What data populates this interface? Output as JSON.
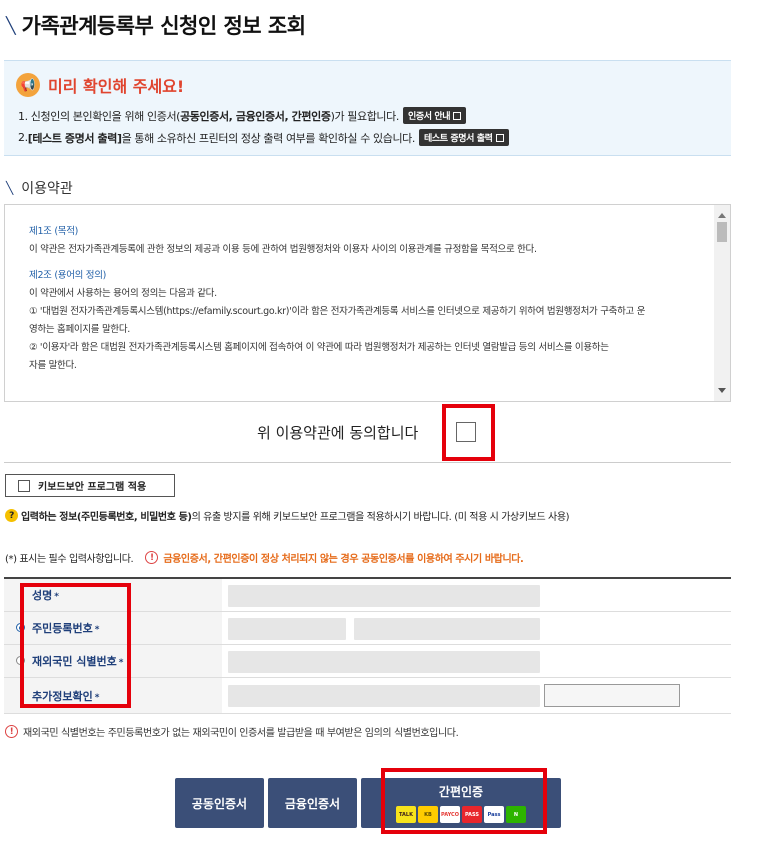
{
  "page": {
    "title": "가족관계등록부 신청인 정보 조회"
  },
  "notice": {
    "title": "미리 확인해 주세요!",
    "line1_pre": "1. 신청인의 본인확인을 위해 인증서(",
    "line1_bold": "공동인증서, 금융인증서, 간편인증",
    "line1_post": ")가 필요합니다.",
    "line1_button": "인증서 안내",
    "line2_pre": "2. ",
    "line2_bold": "[테스트 증명서 출력]",
    "line2_post": "을 통해 소유하신 프린터의 정상 출력 여부를 확인하실 수 있습니다.",
    "line2_button": "테스트 증명서 출력"
  },
  "terms": {
    "section_title": "이용약관",
    "article1_title": "제1조 (목적)",
    "article1_body": "이 약관은 전자가족관계등록에 관한 정보의 제공과 이용 등에 관하여 법원행정처와 이용자 사이의 이용관계를 규정함을 목적으로 한다.",
    "article2_title": "제2조 (용어의 정의)",
    "article2_intro": "이 약관에서 사용하는 용어의 정의는 다음과 같다.",
    "article2_item1a": "① '대법원 전자가족관계등록시스템(https://efamily.scourt.go.kr)'이라 함은 전자가족관계등록 서비스를 인터넷으로 제공하기 위하여 법원행정처가 구축하고 운",
    "article2_item1b": "영하는 홈페이지를 말한다.",
    "article2_item2a": "② '이용자'라 함은 대법원 전자가족관계등록시스템 홈페이지에 접속하여 이 약관에 따라 법원행정처가 제공하는 인터넷 열람발급 등의 서비스를 이용하는",
    "article2_item2b": "자를 말한다.",
    "agree_label": "위 이용약관에 동의합니다"
  },
  "security": {
    "keyboard_button": "키보드보안 프로그램 적용",
    "keyboard_info_bold": "입력하는 정보(주민등록번호, 비밀번호 등)",
    "keyboard_info_post": "의 유출 방지를 위해 키보드보안 프로그램을 적용하시기 바랍니다. (미 적용 시 가상키보드 사용)"
  },
  "form": {
    "required_note": "(*) 표시는 필수 입력사항입니다.",
    "warning": "금융인증서, 간편인증이 정상 처리되지 않는 경우 공동인증서를 이용하여 주시기 바랍니다.",
    "fields": [
      {
        "label": "성명",
        "star": "*"
      },
      {
        "label": "주민등록번호",
        "star": "*"
      },
      {
        "label": "재외국민 식별번호",
        "star": "*"
      },
      {
        "label": "추가정보확인",
        "star": "*"
      }
    ],
    "footnote": "재외국민 식별번호는 주민등록번호가 없는 재외국민이 인증서를 발급받을 때 부여받은 임의의 식별번호입니다."
  },
  "auth": {
    "joint": "공동인증서",
    "financial": "금융인증서",
    "simple": "간편인증",
    "logos": [
      {
        "name": "kakao",
        "text": "TALK",
        "bg": "#f7e31b",
        "fg": "#3a1d1d"
      },
      {
        "name": "kb",
        "text": "KB",
        "bg": "#ffcc00",
        "fg": "#5a4a00"
      },
      {
        "name": "payco",
        "text": "PAYCO",
        "bg": "#ffffff",
        "fg": "#e53935"
      },
      {
        "name": "pass",
        "text": "PASS",
        "bg": "#e8262c",
        "fg": "#ffffff"
      },
      {
        "name": "samsung-pass",
        "text": "Pass",
        "bg": "#ffffff",
        "fg": "#1a3f9c"
      },
      {
        "name": "naver",
        "text": "N",
        "bg": "#2db400",
        "fg": "#ffffff"
      }
    ]
  },
  "colors": {
    "title_accent": "#1f3f7a",
    "notice_title": "#e0452f",
    "highlight_box": "#e5000b",
    "button_bg": "#3b4f78",
    "warning_text": "#e66b1a"
  }
}
